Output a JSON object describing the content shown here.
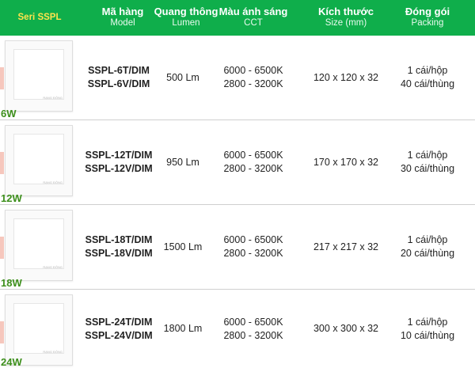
{
  "header": {
    "series": "Seri SSPL",
    "columns": [
      {
        "main": "Mã hàng",
        "sub": "Model"
      },
      {
        "main": "Quang thông",
        "sub": "Lumen"
      },
      {
        "main": "Màu ánh sáng",
        "sub": "CCT"
      },
      {
        "main": "Kích thước",
        "sub": "Size (mm)"
      },
      {
        "main": "Đóng gói",
        "sub": "Packing"
      }
    ]
  },
  "rows": [
    {
      "watt": "6W",
      "thumb_mark": "RẠNG ĐÔNG",
      "model": [
        "SSPL-6T/DIM",
        "SSPL-6V/DIM"
      ],
      "lumen": "500 Lm",
      "cct": [
        "6000 - 6500K",
        "2800 - 3200K"
      ],
      "size": "120 x 120 x 32",
      "packing": [
        "1 cái/hộp",
        "40 cái/thùng"
      ]
    },
    {
      "watt": "12W",
      "thumb_mark": "RẠNG ĐÔNG",
      "model": [
        "SSPL-12T/DIM",
        "SSPL-12V/DIM"
      ],
      "lumen": "950 Lm",
      "cct": [
        "6000 - 6500K",
        "2800 - 3200K"
      ],
      "size": "170 x 170 x 32",
      "packing": [
        "1 cái/hộp",
        "30 cái/thùng"
      ]
    },
    {
      "watt": "18W",
      "thumb_mark": "RẠNG ĐÔNG",
      "model": [
        "SSPL-18T/DIM",
        "SSPL-18V/DIM"
      ],
      "lumen": "1500 Lm",
      "cct": [
        "6000 - 6500K",
        "2800 - 3200K"
      ],
      "size": "217 x 217 x 32",
      "packing": [
        "1 cái/hộp",
        "20 cái/thùng"
      ]
    },
    {
      "watt": "24W",
      "thumb_mark": "RẠNG ĐÔNG",
      "model": [
        "SSPL-24T/DIM",
        "SSPL-24V/DIM"
      ],
      "lumen": "1800 Lm",
      "cct": [
        "6000 - 6500K",
        "2800 - 3200K"
      ],
      "size": "300 x 300 x 32",
      "packing": [
        "1 cái/hộp",
        "10 cái/thùng"
      ]
    }
  ],
  "colors": {
    "header_bg": "#0fae4b",
    "series_text": "#ffe34d",
    "watt_text": "#3d8f1c"
  }
}
